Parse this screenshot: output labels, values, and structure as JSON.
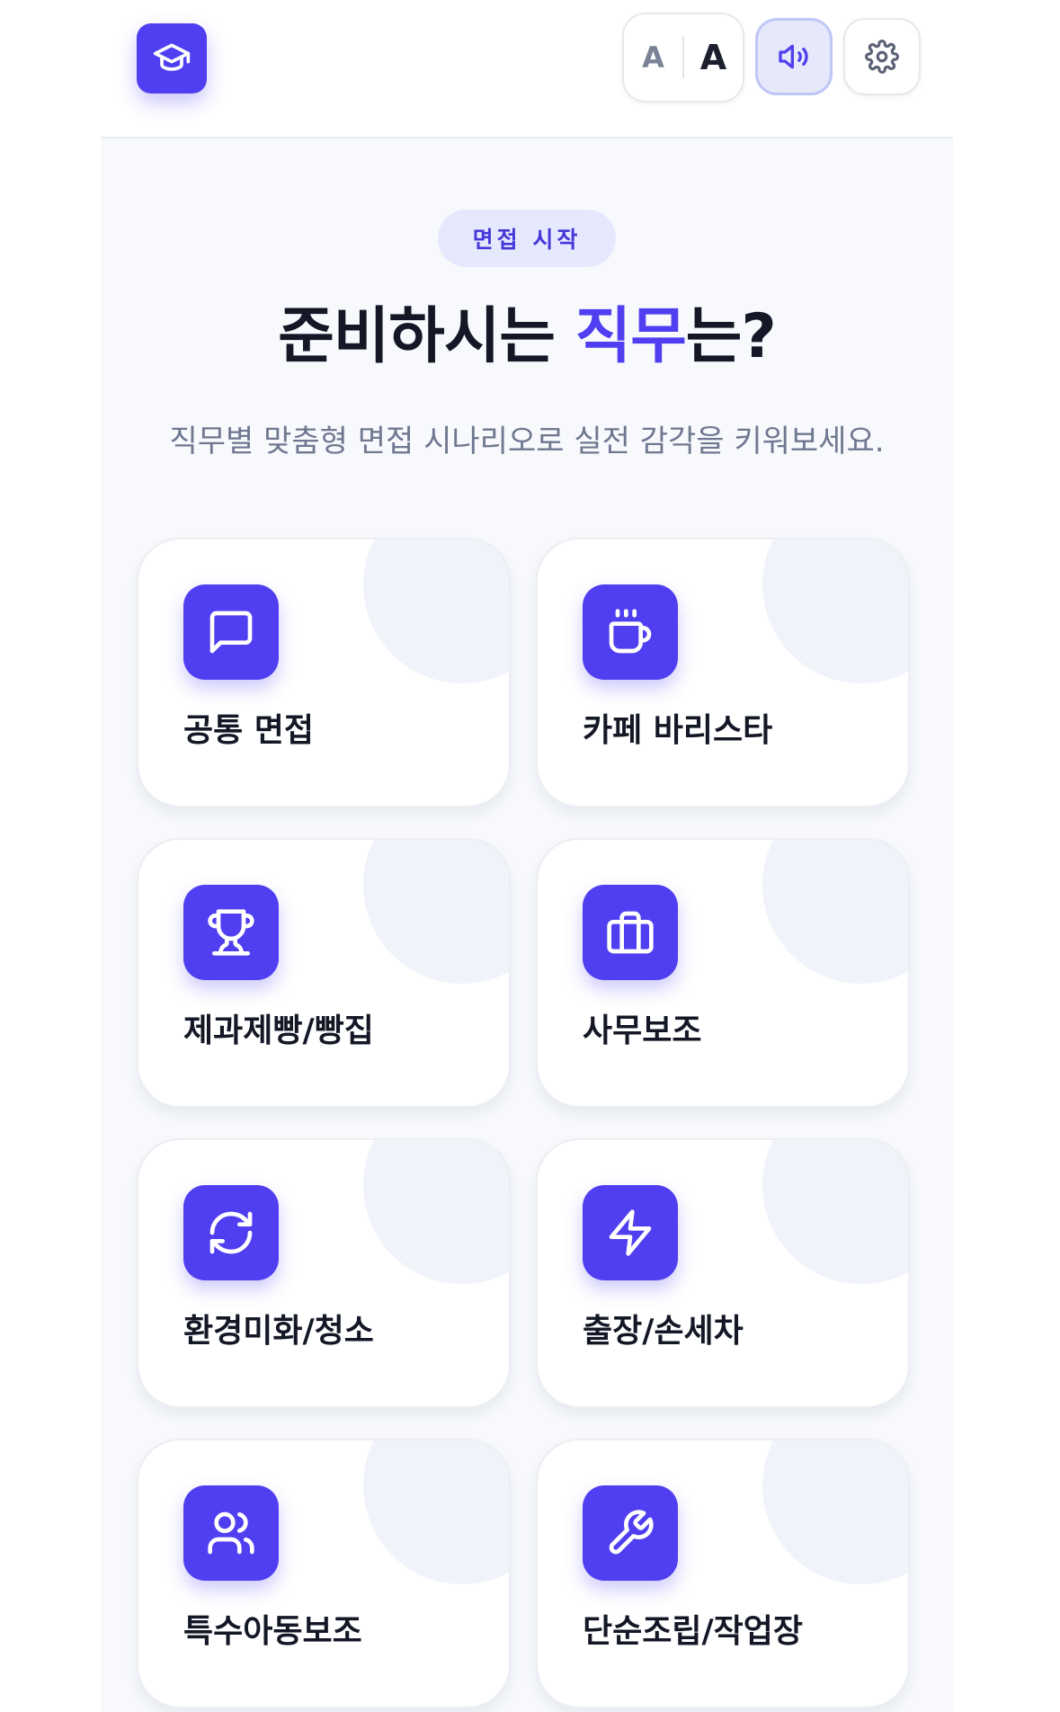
{
  "header": {
    "logo_icon": "graduation-cap-icon",
    "font_small_label": "A",
    "font_large_label": "A",
    "speaker_icon": "speaker-icon",
    "settings_icon": "gear-icon"
  },
  "main": {
    "badge": "면접 시작",
    "title_prefix": "준비하시는 ",
    "title_accent": "직무",
    "title_suffix": "는?",
    "subtitle": "직무별 맞춤형 면접 시나리오로 실전 감각을 키워보세요.",
    "jobs": [
      {
        "label": "공통 면접",
        "icon": "chat-bubble-icon"
      },
      {
        "label": "카페 바리스타",
        "icon": "coffee-cup-icon"
      },
      {
        "label": "제과제빵/빵집",
        "icon": "trophy-icon"
      },
      {
        "label": "사무보조",
        "icon": "briefcase-icon"
      },
      {
        "label": "환경미화/청소",
        "icon": "refresh-icon"
      },
      {
        "label": "출장/손세차",
        "icon": "lightning-icon"
      },
      {
        "label": "특수아동보조",
        "icon": "users-icon"
      },
      {
        "label": "단순조립/작업장",
        "icon": "wrench-icon"
      }
    ]
  },
  "colors": {
    "accent": "#4f3ff0",
    "badge_bg": "#e6e8fd",
    "page_bg": "#f7f9fc",
    "text_dark": "#141826",
    "text_muted": "#6f7890"
  }
}
